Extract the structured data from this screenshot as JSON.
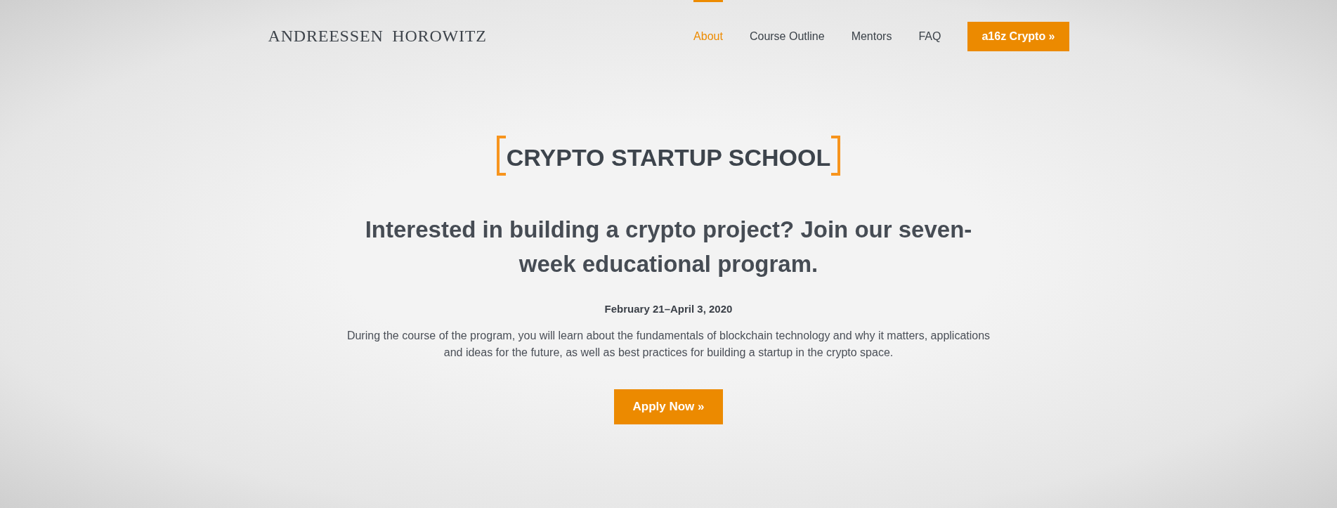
{
  "header": {
    "logo": "ANDREESSEN HOROWITZ",
    "nav": [
      {
        "label": "About",
        "selected": true
      },
      {
        "label": "Course Outline",
        "selected": false
      },
      {
        "label": "Mentors",
        "selected": false
      },
      {
        "label": "FAQ",
        "selected": false
      }
    ],
    "cta_button": "a16z Crypto »"
  },
  "hero": {
    "title": "CRYPTO STARTUP SCHOOL",
    "headline": "Interested in building a crypto project? Join our seven-week educational program.",
    "dates": "February 21–April 3, 2020",
    "description": "During the course of the program, you will learn about the fundamentals of blockchain technology and why it matters, applications and ideas for the future, as well as best practices for building a startup in the crypto space.",
    "apply_button": "Apply Now »"
  }
}
